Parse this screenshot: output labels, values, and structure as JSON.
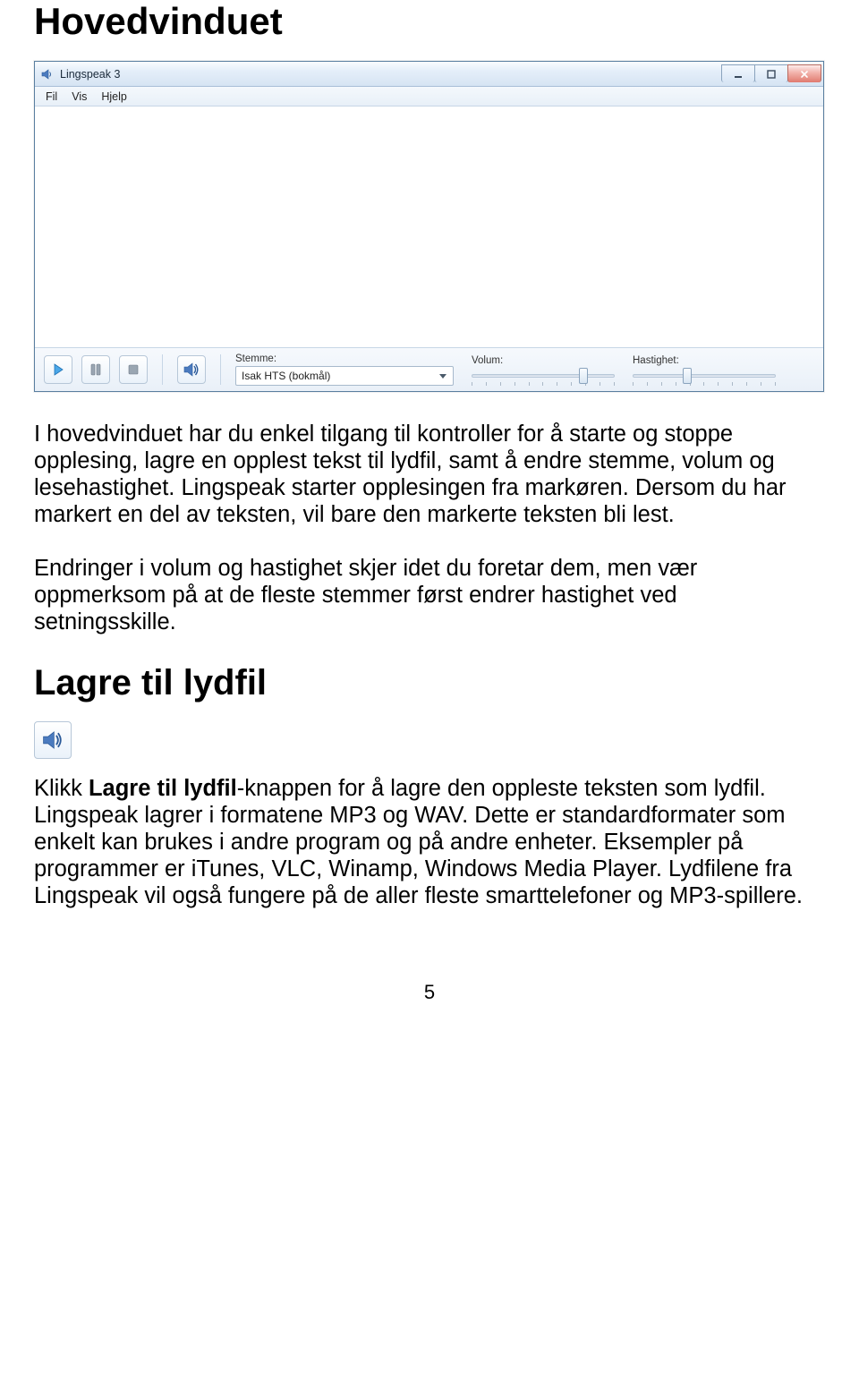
{
  "doc": {
    "heading1": "Hovedvinduet",
    "paragraph1": "I hovedvinduet har du enkel tilgang til kontroller for å starte og stoppe opplesing, lagre en opplest tekst til lydfil, samt å endre stemme, volum og lesehastighet. Lingspeak starter opplesingen fra markøren. Dersom du har markert en del av teksten, vil bare den markerte teksten bli lest.",
    "paragraph2": "Endringer i volum og hastighet skjer idet du foretar dem, men vær oppmerksom på at de fleste stemmer først endrer hastighet ved setningsskille.",
    "heading2": "Lagre til lydfil",
    "p3_pre": "Klikk ",
    "p3_bold": "Lagre til lydfil",
    "p3_post": "-knappen for å lagre den oppleste teksten som lydfil. Lingspeak lagrer i formatene MP3 og WAV. Dette er standardformater som enkelt kan brukes i andre program og på andre enheter. Eksempler på programmer er iTunes, VLC, Winamp, Windows Media Player. Lydfilene fra Lingspeak vil også fungere på de aller fleste smarttelefoner og MP3-spillere.",
    "page_number": "5"
  },
  "window": {
    "title": "Lingspeak 3",
    "menus": {
      "fil": "Fil",
      "vis": "Vis",
      "hjelp": "Hjelp"
    },
    "labels": {
      "stemme": "Stemme:",
      "volum": "Volum:",
      "hastighet": "Hastighet:"
    },
    "voice_selected": "Isak HTS (bokmål)",
    "volum_percent": 78,
    "hastighet_percent": 38
  },
  "icons": {
    "app": "speaker-icon",
    "minimize": "minimize-icon",
    "maximize": "maximize-icon",
    "close": "close-icon",
    "play": "play-icon",
    "pause": "pause-icon",
    "stop": "stop-icon",
    "save_audio": "save-audio-icon",
    "chevron_down": "chevron-down-icon"
  }
}
